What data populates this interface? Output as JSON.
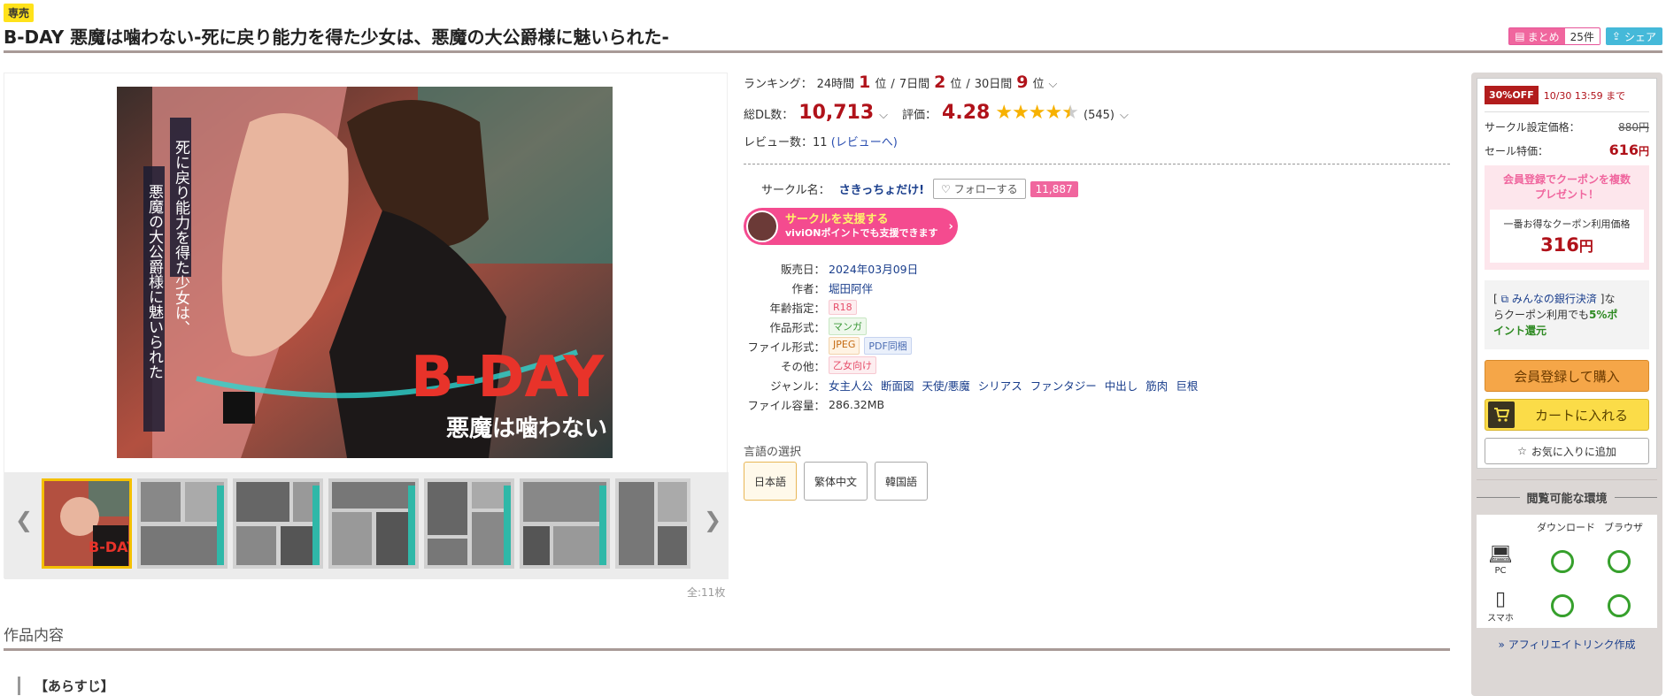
{
  "header": {
    "badge": "専売",
    "title": "B-DAY 悪魔は噛わない-死に戻り能力を得た少女は、悪魔の大公爵様に魅いられた-",
    "matome_label": "まとめ",
    "matome_count": "25件",
    "share_label": "シェア"
  },
  "gallery": {
    "cover_vertical_text_1": "死に戻り能力を得た少女は、",
    "cover_vertical_text_2": "悪魔の大公爵様に魅いられた",
    "cover_logo": "B-DAY",
    "cover_sublogo": "悪魔は噛わない",
    "prev_icon": "chevron-left-icon",
    "next_icon": "chevron-right-icon",
    "count_note": "全:11枚"
  },
  "ranking": {
    "label": "ランキング：",
    "p24_label": "24時間",
    "p24_value": "1",
    "p7_label": "7日間",
    "p7_value": "2",
    "p30_label": "30日間",
    "p30_value": "9",
    "unit": "位",
    "sep": "/"
  },
  "sales": {
    "dl_label": "総DL数：",
    "dl_value": "10,713",
    "rating_label": "評価：",
    "rating_value": "4.28",
    "rating_stars": 4.28,
    "rating_count": "(545)"
  },
  "reviews": {
    "label": "レビュー数：11",
    "link": "(レビューへ)"
  },
  "circle": {
    "label": "サークル名：",
    "name": "さきっちょだけ!",
    "follow_label": "フォローする",
    "follow_count": "11,887",
    "support_line1": "サークルを支援する",
    "support_line2": "viviONポイントでも支援できます"
  },
  "specs": [
    {
      "label": "販売日：",
      "values": [
        "2024年03月09日"
      ]
    },
    {
      "label": "作者：",
      "values": [
        "堀田阿伴"
      ]
    },
    {
      "label": "年齢指定：",
      "tag": "R18"
    },
    {
      "label": "作品形式：",
      "tag": "マンガ"
    },
    {
      "label": "ファイル形式：",
      "tags": [
        "JPEG",
        "PDF同梱"
      ]
    },
    {
      "label": "その他：",
      "tag": "乙女向け"
    },
    {
      "label": "ジャンル：",
      "values": [
        "女主人公",
        "断面図",
        "天使/悪魔",
        "シリアス",
        "ファンタジー",
        "中出し",
        "筋肉",
        "巨根"
      ]
    },
    {
      "label": "ファイル容量：",
      "values": [
        "286.32MB"
      ]
    }
  ],
  "language": {
    "label": "言語の選択",
    "options": [
      "日本語",
      "繁体中文",
      "韓国語"
    ],
    "selected": "日本語"
  },
  "section": {
    "title": "作品内容",
    "synopsis_heading": "【あらすじ】"
  },
  "sidebar": {
    "off_badge": "30%OFF",
    "off_until": "10/30 13:59 まで",
    "list_price_label": "サークル設定価格：",
    "list_price": "880円",
    "sale_label": "セール特価：",
    "sale_price": "616",
    "sale_unit": "円",
    "coupon_head_1": "会員登録でクーポンを複数",
    "coupon_head_2": "プレゼント！",
    "coupon_caption": "一番お得なクーポン利用価格",
    "coupon_price": "316",
    "coupon_unit": "円",
    "bank_prefix": "[",
    "bank_link": "みんなの銀行決済",
    "bank_suffix": "]な",
    "bank_line2_a": "らクーポン利用でも",
    "bank_pct": "5%ポ",
    "bank_line3": "イント還元",
    "buy_label": "会員登録して購入",
    "cart_label": "カートに入れる",
    "fav_label": "お気に入りに追加",
    "env_title": "閲覧可能な環境",
    "env_col_download": "ダウンロード",
    "env_col_browser": "ブラウザ",
    "env_pc": "PC",
    "env_phone": "スマホ",
    "affiliate": "» アフィリエイトリンク作成"
  },
  "colors": {
    "accent_red": "#b0121a",
    "pink": "#f0669e",
    "star": "#f7b100",
    "ok_green": "#36a02c"
  }
}
